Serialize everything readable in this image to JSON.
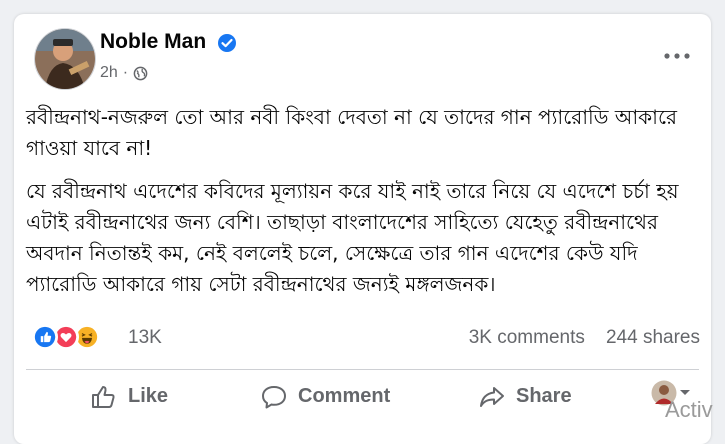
{
  "post": {
    "author": "Noble Man",
    "time": "2h",
    "separator": "·",
    "paragraphs": [
      "রবীন্দ্রনাথ-নজরুল তো আর নবী কিংবা দেবতা না যে তাদের গান প্যারোডি আকারে গাওয়া যাবে না!",
      "যে রবীন্দ্রনাথ এদেশের কবিদের মূল্যায়ন করে যাই নাই তারে নিয়ে যে এদেশে চর্চা হয় এটাই রবীন্দ্রনাথের জন্য বেশি। তাছাড়া বাংলাদেশের সাহিত্যে যেহেতু রবীন্দ্রনাথের অবদান নিতান্তই কম, নেই বললেই চলে, সেক্ষেত্রে তার গান এদেশের কেউ যদি প্যারোডি আকারে গায় সেটা রবীন্দ্রনাথের জন্যই মঙ্গলজনক।"
    ]
  },
  "stats": {
    "reactions_count": "13K",
    "comments": "3K comments",
    "shares": "244 shares",
    "reaction_icons": [
      "like-icon",
      "love-icon",
      "haha-icon"
    ]
  },
  "actions": {
    "like": "Like",
    "comment": "Comment",
    "share": "Share"
  },
  "watermark": "Activ",
  "colors": {
    "like_blue": "#1877f2",
    "love_red": "#f33e58",
    "haha_yellow": "#f7b125",
    "secondary_text": "#65676b"
  }
}
